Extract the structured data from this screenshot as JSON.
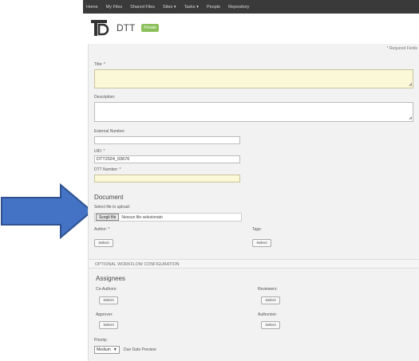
{
  "colors": {
    "arrow_fill": "#4472C4",
    "arrow_stroke": "#2F528F",
    "topbar": "#3a3a3a",
    "badge": "#8bbf5a",
    "required_field": "#fbf8d8"
  },
  "nav": {
    "items": [
      "Home",
      "My Files",
      "Shared Files",
      "Sites ▾",
      "Tasks ▾",
      "People",
      "Repository"
    ]
  },
  "site": {
    "logo_icon": "dtt-logo-icon",
    "title": "DTT",
    "badge": "Private"
  },
  "form": {
    "required_note": "* Required Fields",
    "title_label": "Title: *",
    "description_label": "Description:",
    "external_number_label": "External Number:",
    "uid_label": "UID: *",
    "uid_value": "DTT2024_03676",
    "dtt_number_label": "DTT Number: *",
    "document_heading": "Document",
    "select_file_label": "Select file to upload:",
    "file_button": "Scegli file",
    "file_status": "Nessun file selezionato",
    "author_label": "Author: *",
    "author_button": "Select",
    "tags_label": "Tags:",
    "tags_button": "Select",
    "optional_heading": "OPTIONAL WORKFLOW CONFIGURATION",
    "assignees_heading": "Assignees",
    "coauthors_label": "Co-Authors:",
    "coauthors_button": "Select",
    "reviewers_label": "Reviewers:",
    "reviewers_button": "Select",
    "approver_label": "Approver:",
    "approver_button": "Select",
    "authorizer_label": "Authorizer:",
    "authorizer_button": "Select",
    "priority_label": "Priority:",
    "priority_value": "Medium",
    "due_date_label": "Due Date Preview:"
  }
}
